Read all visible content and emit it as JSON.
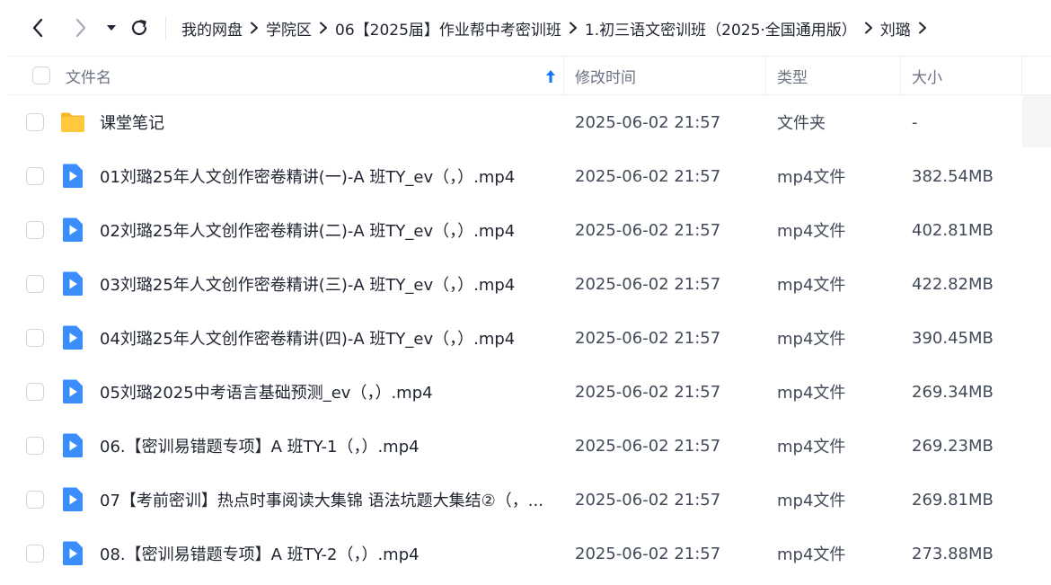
{
  "nav": {
    "back_icon": "chevron-left-icon",
    "forward_icon": "chevron-right-icon",
    "history_icon": "caret-down-icon",
    "refresh_icon": "refresh-icon"
  },
  "breadcrumb": [
    "我的网盘",
    "学院区",
    "06【2025届】作业帮中考密训班",
    "1.初三语文密训班（2025·全国通用版）",
    "刘璐"
  ],
  "table": {
    "columns": {
      "name": "文件名",
      "modified": "修改时间",
      "type": "类型",
      "size": "大小"
    },
    "rows": [
      {
        "icon": "folder-icon",
        "name": "课堂笔记",
        "modified": "2025-06-02 21:57",
        "type": "文件夹",
        "size": "-"
      },
      {
        "icon": "video-file-icon",
        "name": "01刘璐25年人文创作密卷精讲(一)-A 班TY_ev（，）.mp4",
        "modified": "2025-06-02 21:57",
        "type": "mp4文件",
        "size": "382.54MB"
      },
      {
        "icon": "video-file-icon",
        "name": "02刘璐25年人文创作密卷精讲(二)-A 班TY_ev（，）.mp4",
        "modified": "2025-06-02 21:57",
        "type": "mp4文件",
        "size": "402.81MB"
      },
      {
        "icon": "video-file-icon",
        "name": "03刘璐25年人文创作密卷精讲(三)-A 班TY_ev（，）.mp4",
        "modified": "2025-06-02 21:57",
        "type": "mp4文件",
        "size": "422.82MB"
      },
      {
        "icon": "video-file-icon",
        "name": "04刘璐25年人文创作密卷精讲(四)-A 班TY_ev（，）.mp4",
        "modified": "2025-06-02 21:57",
        "type": "mp4文件",
        "size": "390.45MB"
      },
      {
        "icon": "video-file-icon",
        "name": "05刘璐2025中考语言基础预测_ev（，）.mp4",
        "modified": "2025-06-02 21:57",
        "type": "mp4文件",
        "size": "269.34MB"
      },
      {
        "icon": "video-file-icon",
        "name": "06.【密训易错题专项】A 班TY-1（，）.mp4",
        "modified": "2025-06-02 21:57",
        "type": "mp4文件",
        "size": "269.23MB"
      },
      {
        "icon": "video-file-icon",
        "name": "07【考前密训】热点时事阅读大集锦 语法坑题大集结②（，...",
        "modified": "2025-06-02 21:57",
        "type": "mp4文件",
        "size": "269.81MB"
      },
      {
        "icon": "video-file-icon",
        "name": "08.【密训易错题专项】A 班TY-2（，）.mp4",
        "modified": "2025-06-02 21:57",
        "type": "mp4文件",
        "size": "273.88MB"
      }
    ]
  },
  "colors": {
    "accent": "#1677ff",
    "folder": "#ffc83d",
    "video": "#3a8dfb",
    "header_text": "#6b7282"
  }
}
